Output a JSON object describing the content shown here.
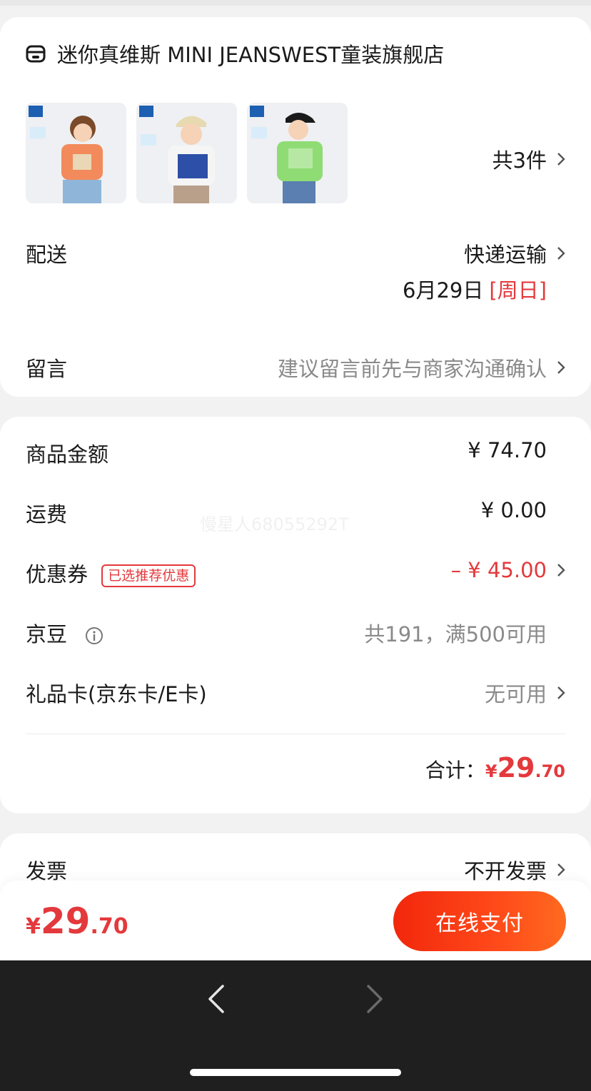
{
  "store": {
    "name": "迷你真维斯 MINI JEANSWEST童装旗舰店",
    "item_count": "共3件"
  },
  "products": [
    {
      "shirt_color": "#f28a5c",
      "pants_color": "#8fb6d9"
    },
    {
      "shirt_color": "#f5f5f5",
      "pants_color": "#b9a08a"
    },
    {
      "shirt_color": "#8fdc74",
      "pants_color": "#5a7fb0"
    }
  ],
  "delivery": {
    "label": "配送",
    "method": "快递运输",
    "date": "6月29日",
    "weekday": "[周日]"
  },
  "message": {
    "label": "留言",
    "placeholder": "建议留言前先与商家沟通确认"
  },
  "summary": {
    "goods_label": "商品金额",
    "goods_value": "¥ 74.70",
    "shipping_label": "运费",
    "shipping_value": "¥ 0.00",
    "coupon_label": "优惠券",
    "coupon_tag": "已选推荐优惠",
    "coupon_value": "– ¥ 45.00",
    "jingdou_label": "京豆",
    "jingdou_value": "共191，满500可用",
    "giftcard_label": "礼品卡(京东卡/E卡)",
    "giftcard_value": "无可用",
    "total_label": "合计：",
    "total_currency": "¥",
    "total_int": "29",
    "total_dec": ".70"
  },
  "watermark": "慢星人68055292T",
  "invoice": {
    "label": "发票",
    "value": "不开发票"
  },
  "bottom": {
    "currency": "¥",
    "price_int": "29",
    "price_dec": ".70",
    "pay_label": "在线支付"
  },
  "colors": {
    "accent_red": "#e4393c",
    "pay_button": "#f2270c"
  }
}
